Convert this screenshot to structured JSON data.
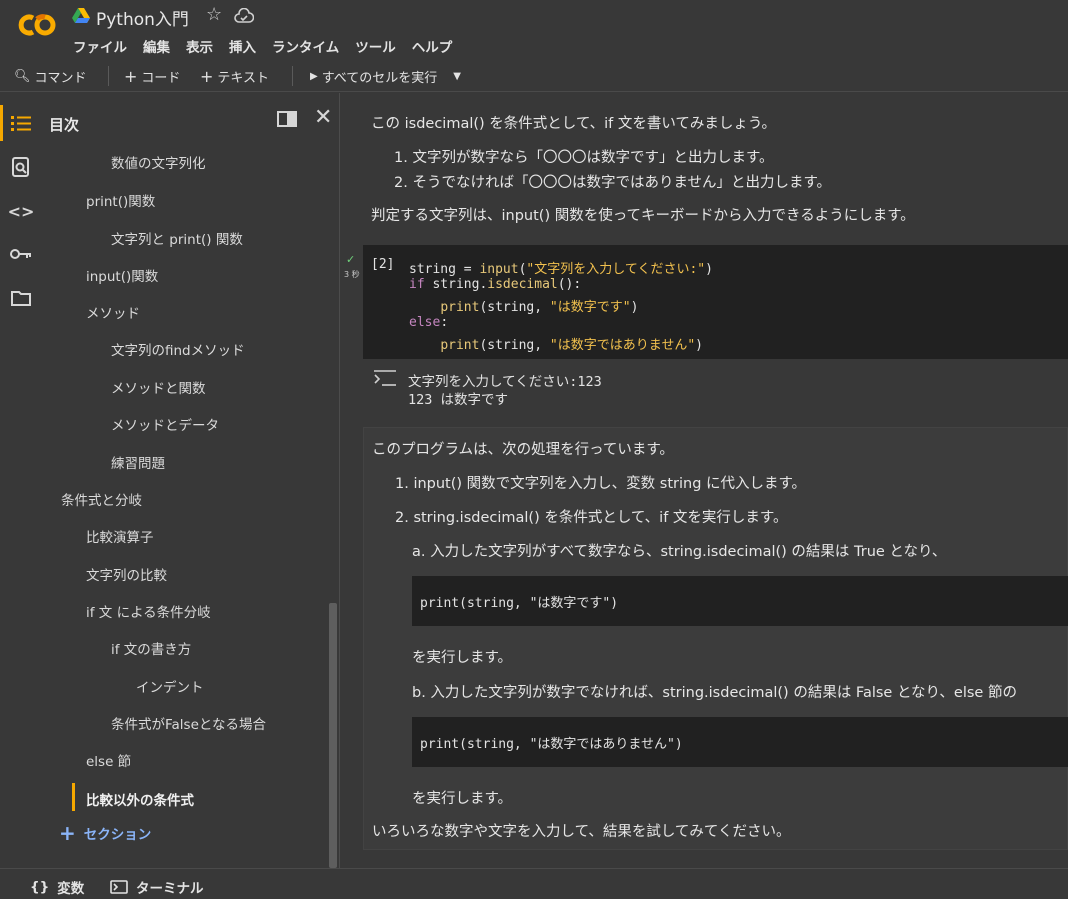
{
  "header": {
    "title": "Python入門",
    "menu": [
      "ファイル",
      "編集",
      "表示",
      "挿入",
      "ランタイム",
      "ツール",
      "ヘルプ"
    ]
  },
  "toolbar": {
    "command": "コマンド",
    "add_code": "コード",
    "add_text": "テキスト",
    "run_all": "すべてのセルを実行"
  },
  "toc": {
    "title": "目次",
    "items": [
      {
        "label": "数値の文字列化",
        "level": 3
      },
      {
        "label": "print()関数",
        "level": 2
      },
      {
        "label": "文字列と print() 関数",
        "level": 3
      },
      {
        "label": "input()関数",
        "level": 2
      },
      {
        "label": "メソッド",
        "level": 2
      },
      {
        "label": "文字列のfindメソッド",
        "level": 3
      },
      {
        "label": "メソッドと関数",
        "level": 3
      },
      {
        "label": "メソッドとデータ",
        "level": 3
      },
      {
        "label": "練習問題",
        "level": 3
      },
      {
        "label": "条件式と分岐",
        "level": 1
      },
      {
        "label": "比較演算子",
        "level": 2
      },
      {
        "label": "文字列の比較",
        "level": 2
      },
      {
        "label": "if 文 による条件分岐",
        "level": 2
      },
      {
        "label": "if 文の書き方",
        "level": 3
      },
      {
        "label": "インデント",
        "level": 4
      },
      {
        "label": "条件式がFalseとなる場合",
        "level": 3
      },
      {
        "label": "else 節",
        "level": 2
      },
      {
        "label": "比較以外の条件式",
        "level": 2,
        "active": true
      }
    ],
    "add_section": "セクション"
  },
  "cell1": {
    "intro": "この isdecimal() を条件式として、if 文を書いてみましょう。",
    "list": [
      "1. 文字列が数字なら「〇〇〇は数字です」と出力します。",
      "2. そうでなければ「〇〇〇は数字ではありません」と出力します。"
    ],
    "note": "判定する文字列は、input() 関数を使ってキーボードから入力できるようにします。"
  },
  "code_cell": {
    "exec_count": "[2]",
    "run_time": "3 秒",
    "lines": [
      "string = input(\"文字列を入力してください:\")",
      "if string.isdecimal():",
      "    print(string, \"は数字です\")",
      "else:",
      "    print(string, \"は数字ではありません\")"
    ],
    "output": [
      "文字列を入力してください:123",
      "123 は数字です"
    ]
  },
  "cell2": {
    "intro": "このプログラムは、次の処理を行っています。",
    "item1": "1. input() 関数で文字列を入力し、変数 string に代入します。",
    "item2": "2. string.isdecimal() を条件式として、if 文を実行します。",
    "sub_a": "a. 入力した文字列がすべて数字なら、string.isdecimal() の結果は True となり、",
    "code_a": "print(string, \"は数字です\")",
    "run_a": "を実行します。",
    "sub_b": "b. 入力した文字列が数字でなければ、string.isdecimal() の結果は False となり、else 節の",
    "code_b": "print(string, \"は数字ではありません\")",
    "run_b": "を実行します。",
    "outro": "いろいろな数字や文字を入力して、結果を試してみてください。"
  },
  "footer": {
    "variables": "変数",
    "terminal": "ターミナル"
  },
  "colors": {
    "accent": "#f6a800",
    "link": "#8ab4f8",
    "background": "#383838",
    "code_bg": "#212121"
  }
}
